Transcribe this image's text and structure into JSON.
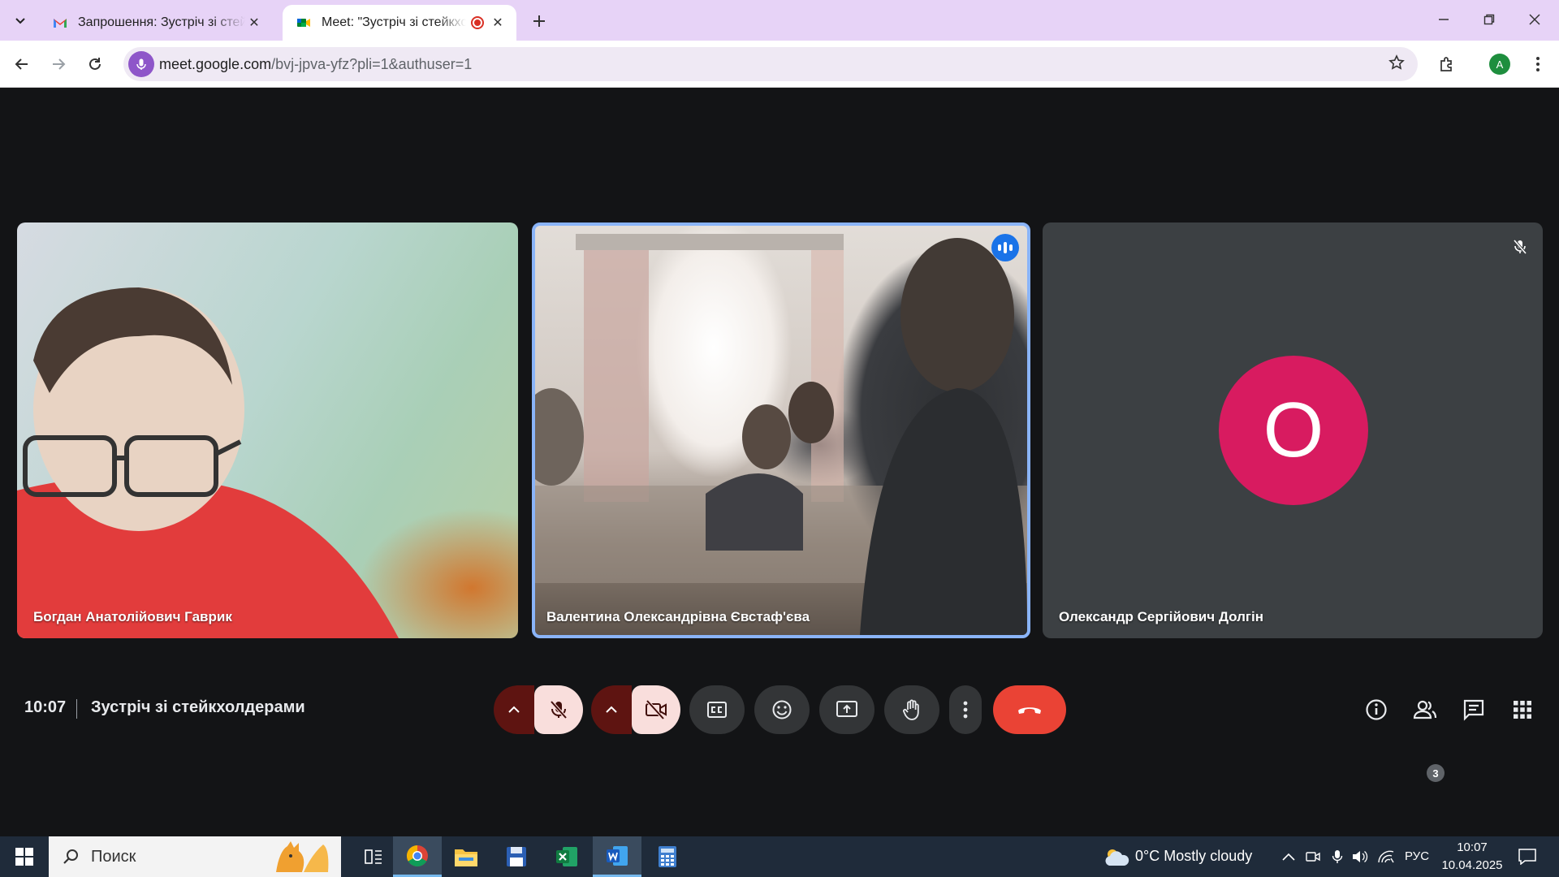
{
  "browser": {
    "tabs": [
      {
        "title": "Запрошення: Зустріч зі стейкхолдерами",
        "favicon": "gmail-icon",
        "active": false
      },
      {
        "title": "Meet: \"Зустріч зі стейкхолдерами\"",
        "favicon": "meet-icon",
        "active": true,
        "recording": true
      }
    ],
    "url_host": "meet.google.com",
    "url_path": "/bvj-jpva-yfz?pli=1&authuser=1",
    "profile_initial": "A",
    "colors": {
      "tabstrip": "#e7d3f7",
      "omnibox": "#efe9f4"
    }
  },
  "meet": {
    "participants": [
      {
        "name": "Богдан Анатолійович Гаврик",
        "video": true,
        "speaking": false
      },
      {
        "name": "Валентина Олександрівна Євстаф'єва",
        "video": true,
        "speaking": true
      },
      {
        "name": "Олександр Сергійович Долгін",
        "video": false,
        "muted": true,
        "initial": "О",
        "avatar_color": "#d81b60"
      }
    ],
    "time": "10:07",
    "meeting_title": "Зустріч зі стейкхолдерами",
    "participant_count": "3",
    "controls": [
      "mic-options",
      "mic-off",
      "camera-options",
      "camera-off",
      "captions",
      "emoji",
      "present",
      "raise-hand",
      "more-options",
      "leave-call"
    ],
    "colors": {
      "end_call": "#ea4335",
      "speaking_border": "#8ab4f8"
    }
  },
  "taskbar": {
    "search_placeholder": "Поиск",
    "weather": "0°C  Mostly cloudy",
    "language": "РУС",
    "clock_time": "10:07",
    "clock_date": "10.04.2025",
    "apps": [
      "chrome-icon",
      "file-explorer-icon",
      "save-icon",
      "excel-icon",
      "word-icon",
      "calculator-icon"
    ]
  }
}
